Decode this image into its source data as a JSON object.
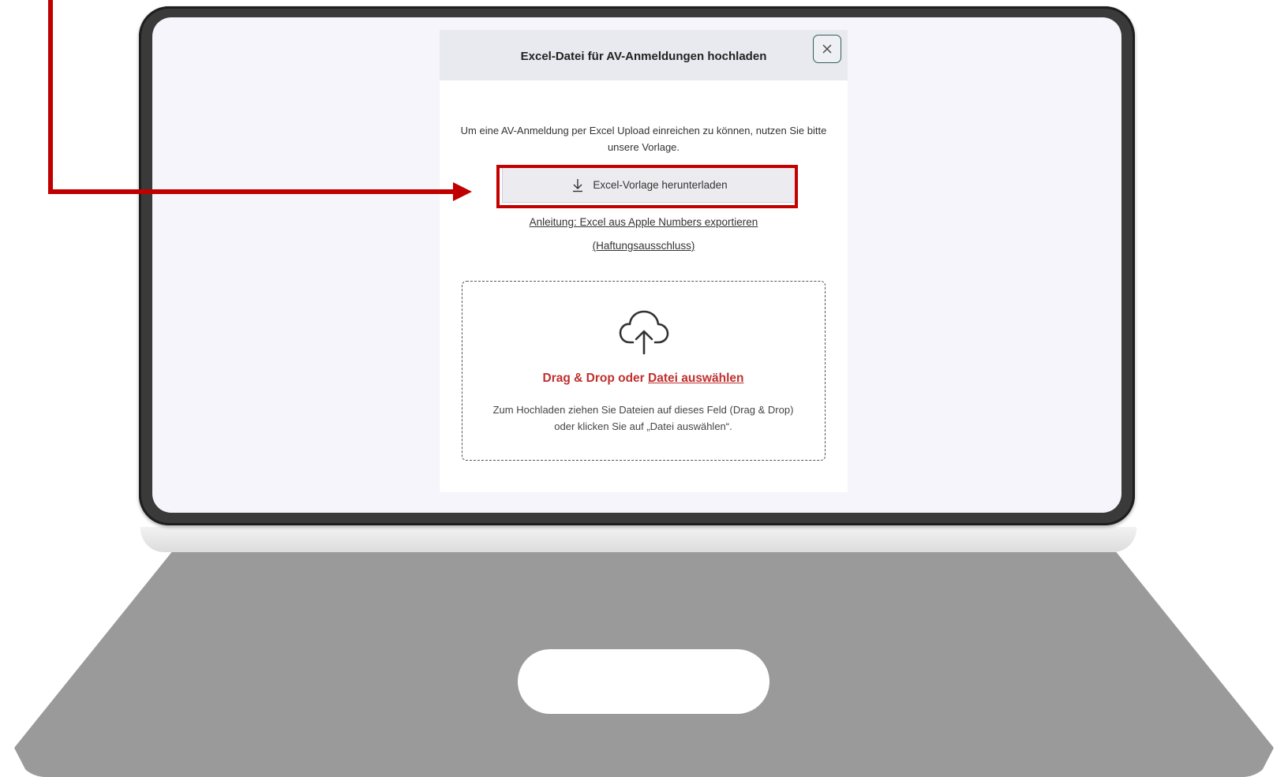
{
  "modal": {
    "title": "Excel-Datei für AV-Anmeldungen hochladen",
    "intro": "Um eine AV-Anmeldung per Excel Upload einreichen zu können, nutzen Sie bitte unsere Vorlage.",
    "download_label": "Excel-Vorlage herunterladen",
    "guide_link": "Anleitung: Excel aus Apple Numbers exportieren",
    "disclaimer_link": "(Haftungsausschluss)",
    "dropzone": {
      "prefix": "Drag & Drop oder",
      "select_link": "Datei auswählen",
      "help": "Zum Hochladen ziehen Sie Dateien auf dieses Feld (Drag & Drop) oder klicken Sie auf „Datei auswählen“."
    }
  },
  "icons": {
    "close": "close-icon",
    "download": "download-icon",
    "upload": "cloud-upload-icon"
  },
  "colors": {
    "accent_red": "#c0302e",
    "annotation_red": "#c00000",
    "close_border": "#2f5f60"
  }
}
